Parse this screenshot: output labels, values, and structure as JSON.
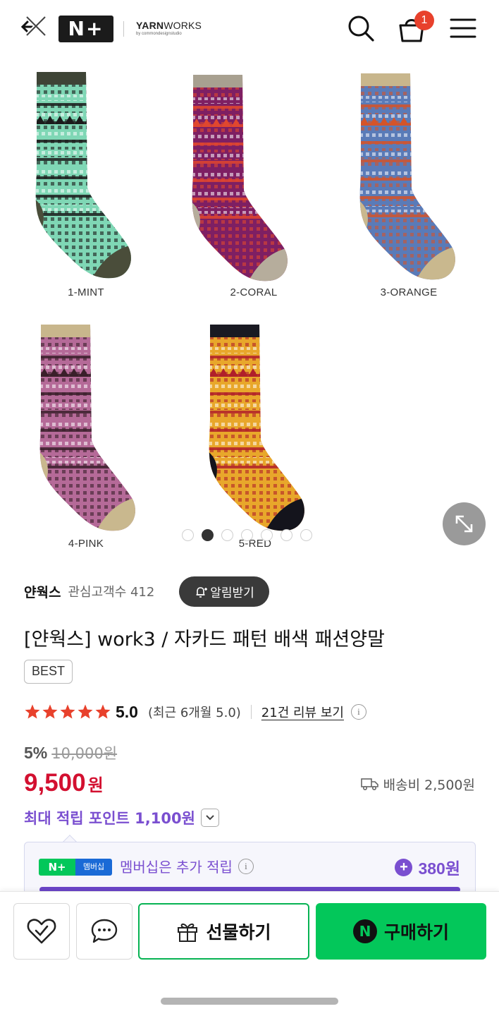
{
  "header": {
    "brand_mark": "N+",
    "store_name_bold": "YARN",
    "store_name_rest": "WORKS",
    "store_subtitle": "by commondesignstudio",
    "cart_count": "1",
    "icons": [
      "back-close-icon",
      "search-icon",
      "shopping-bag-icon",
      "menu-icon"
    ]
  },
  "gallery": {
    "variants": [
      {
        "label": "1-MINT",
        "colors": {
          "base": "#7fd7b5",
          "accent": "#3e4436",
          "heel": "#4a4d3a",
          "pattern": "#1b1b1b"
        }
      },
      {
        "label": "2-CORAL",
        "colors": {
          "base": "#7e1f63",
          "accent": "#a8a090",
          "heel": "#b6ad9c",
          "pattern": "#e0472e"
        }
      },
      {
        "label": "3-ORANGE",
        "colors": {
          "base": "#5a7bb8",
          "accent": "#c8b68c",
          "heel": "#c9b88e",
          "pattern": "#d4542a"
        }
      },
      {
        "label": "4-PINK",
        "colors": {
          "base": "#b56a98",
          "accent": "#c8b68c",
          "heel": "#c9b88e",
          "pattern": "#3a1f2a"
        }
      },
      {
        "label": "5-RED",
        "colors": {
          "base": "#e8a72b",
          "accent": "#1a1a22",
          "heel": "#14141c",
          "pattern": "#b0202a"
        }
      }
    ],
    "page_count": 7,
    "active_page": 2
  },
  "seller": {
    "name": "얀웍스",
    "watchers_label": "관심고객수 412",
    "alert_label": "알림받기"
  },
  "product": {
    "title": "[얀웍스] work3 / 자카드 패턴 배색 패션양말",
    "badge": "BEST"
  },
  "rating": {
    "stars": 5,
    "value": "5.0",
    "recent": "(최근 6개월 5.0)",
    "review_link": "21건 리뷰 보기",
    "star_color": "#e8412c"
  },
  "pricing": {
    "discount": "5%",
    "original_price": "10,000원",
    "price": "9,500",
    "currency": "원",
    "shipping": "배송비 2,500원",
    "max_points": "최대 적립 포인트 1,100원",
    "price_color": "#d31030"
  },
  "membership": {
    "badge_left": "N+",
    "badge_right": "멤버십",
    "text": "멤버십은 추가 적립",
    "points": "380원"
  },
  "actions": {
    "gift_label": "선물하기",
    "buy_label": "구매하기",
    "buy_color": "#03c75a"
  }
}
